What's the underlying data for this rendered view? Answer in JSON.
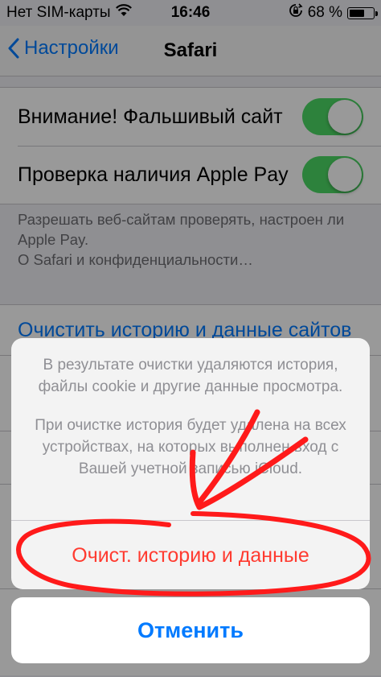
{
  "status_bar": {
    "carrier": "Нет SIM-карты",
    "time": "16:46",
    "battery_percent_label": "68 %",
    "battery_level": 0.68,
    "icons": [
      "wifi-icon",
      "rotation-lock-icon",
      "battery-icon"
    ]
  },
  "nav": {
    "back_label": "Настройки",
    "title": "Safari"
  },
  "settings": {
    "rows": [
      {
        "label": "Внимание! Фальшивый сайт",
        "toggle_on": true
      },
      {
        "label": "Проверка наличия Apple Pay",
        "toggle_on": true
      }
    ],
    "footer_text": "Разрешать веб-сайтам проверять, настроен ли Apple Pay.",
    "footer_link": "О Safari и конфиденциальности…",
    "clear_history_label": "Очистить историю и данные сайтов"
  },
  "action_sheet": {
    "message_1": "В результате очистки удаляются история, файлы cookie и другие данные просмотра.",
    "message_2": "При очистке история будет удалена на всех устройствах, на которых выполнен вход с Вашей учетной записью iCloud.",
    "destructive_label": "Очист. историю и данные",
    "cancel_label": "Отменить"
  },
  "colors": {
    "accent": "#007aff",
    "toggle_on": "#4cd964",
    "destructive": "#ff3b30",
    "annotation": "#ff1a1a"
  }
}
